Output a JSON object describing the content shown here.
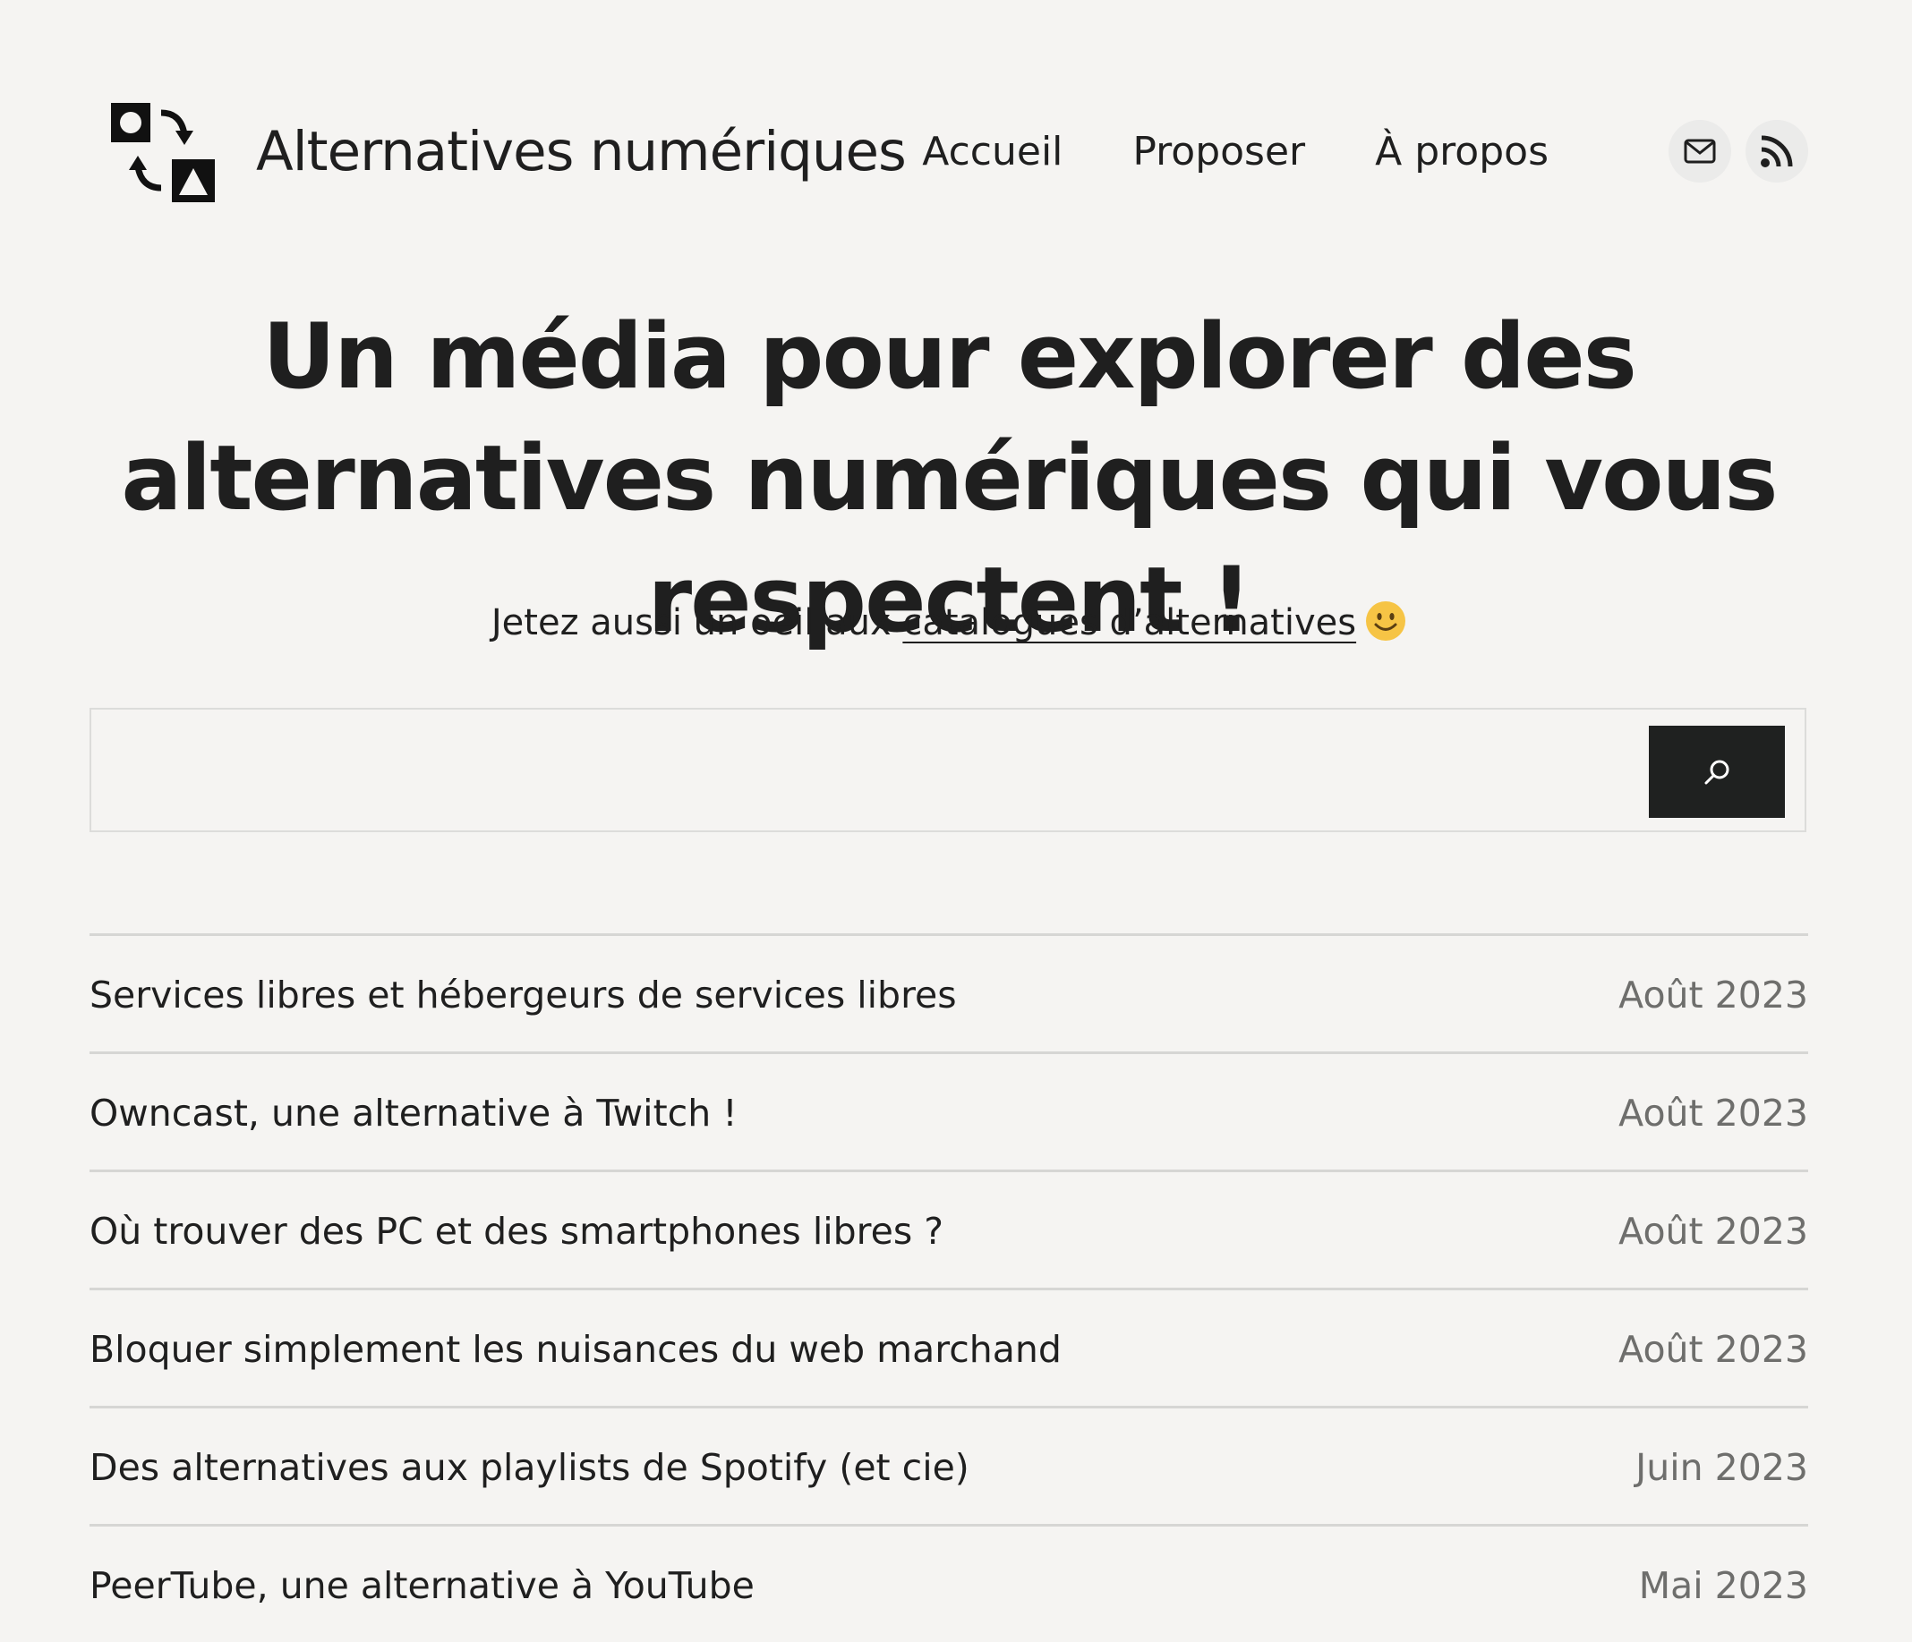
{
  "header": {
    "site_title": "Alternatives numériques",
    "nav": [
      {
        "label": "Accueil"
      },
      {
        "label": "Proposer"
      },
      {
        "label": "À propos"
      }
    ],
    "social": [
      {
        "icon": "mail-icon"
      },
      {
        "icon": "rss-icon"
      }
    ]
  },
  "hero": {
    "headline": "Un média pour explorer des alternatives numériques qui vous respectent !",
    "tagline_prefix": "Jetez aussi un oeil aux ",
    "tagline_link": "catalogues d’alternatives",
    "tagline_emoji": "slightly-smiling-face-icon"
  },
  "search": {
    "value": "",
    "button_icon": "search-icon",
    "button_color": "#1f2120"
  },
  "articles": [
    {
      "title": "Services libres et hébergeurs de services libres",
      "date": "Août 2023"
    },
    {
      "title": "Owncast, une alternative à Twitch !",
      "date": "Août 2023"
    },
    {
      "title": "Où trouver des PC et des smartphones libres ?",
      "date": "Août 2023"
    },
    {
      "title": "Bloquer simplement les nuisances du web marchand",
      "date": "Août 2023"
    },
    {
      "title": "Des alternatives aux playlists de Spotify (et cie)",
      "date": "Juin 2023"
    },
    {
      "title": "PeerTube, une alternative à YouTube",
      "date": "Mai 2023"
    }
  ],
  "colors": {
    "background": "#f5f4f2",
    "text": "#1f1f1f",
    "muted": "#6e6e6c",
    "divider": "#d6d6d4"
  }
}
